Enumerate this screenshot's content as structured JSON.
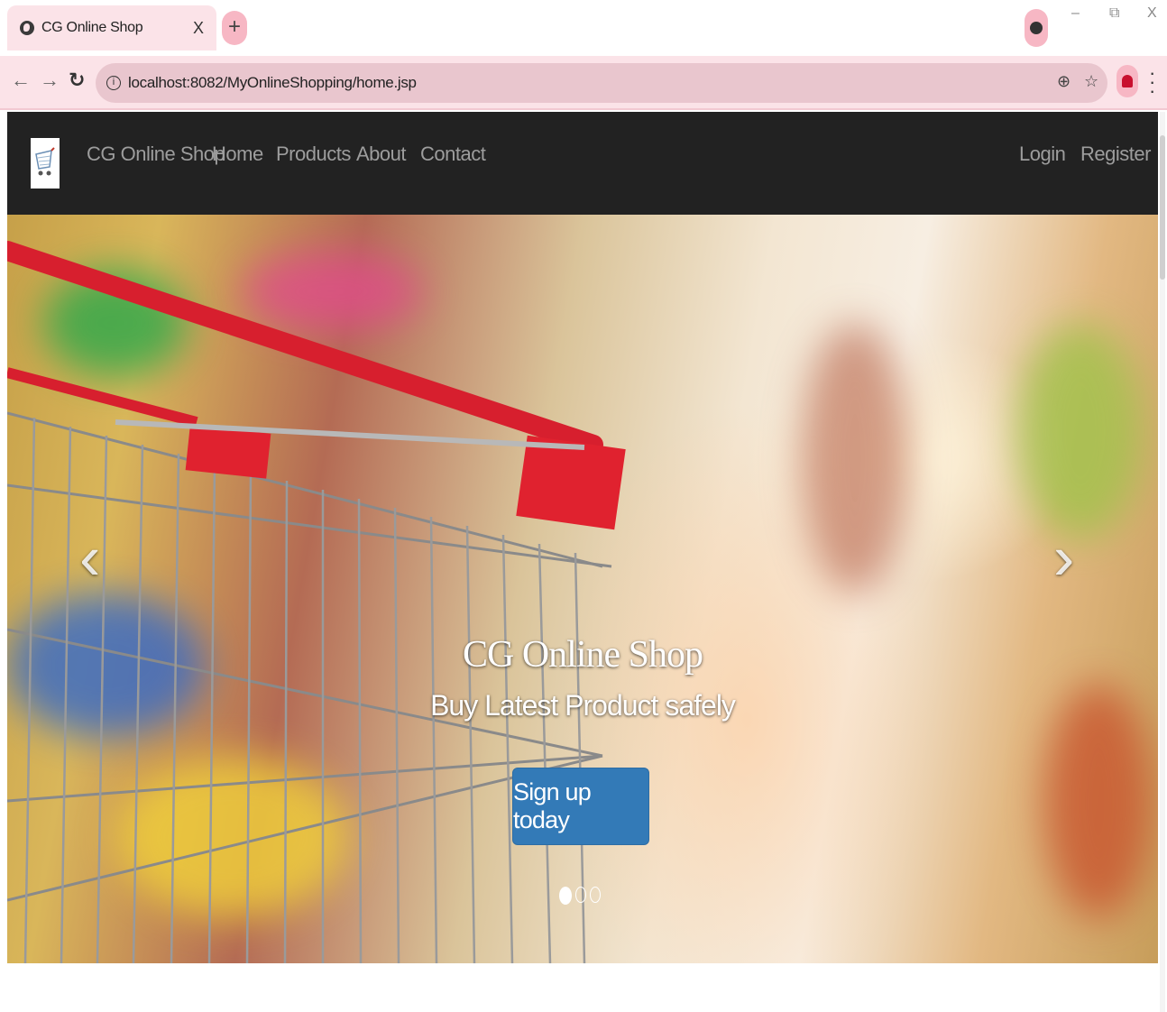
{
  "browser": {
    "tab_title": "CG Online Shop",
    "tab_close": "X",
    "new_tab": "+",
    "url": "localhost:8082/MyOnlineShopping/home.jsp",
    "window_minimize": "–",
    "window_restore": "⧉",
    "window_close": "X"
  },
  "navbar": {
    "brand": "CG Online Shop",
    "links": [
      "Home",
      "Products",
      "About",
      "Contact"
    ],
    "right_links": [
      "Login",
      "Register"
    ]
  },
  "hero": {
    "title": "CG Online Shop",
    "subtitle": "Buy Latest Product safely",
    "cta_label": "Sign up today",
    "prev_arrow": "‹",
    "next_arrow": "›",
    "slide_count": 3,
    "active_slide": 1
  },
  "colors": {
    "navbar_bg": "#222222",
    "nav_link": "#9d9d9d",
    "cta_bg": "#337ab7",
    "browser_chrome": "#fbe3e8"
  }
}
